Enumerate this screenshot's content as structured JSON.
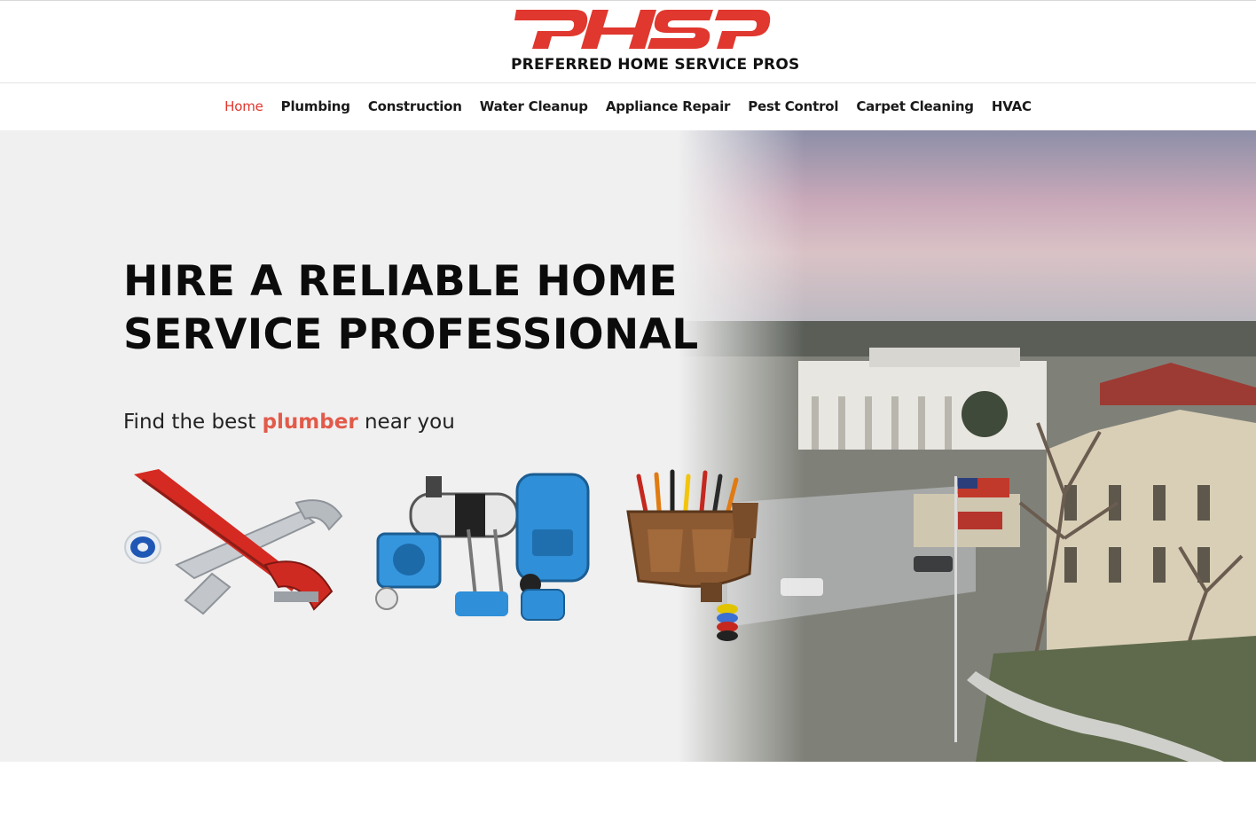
{
  "brand": {
    "logo_text": "PHSP",
    "tagline": "PREFERRED HOME SERVICE PROS",
    "logo_color": "#e0372e"
  },
  "nav": {
    "items": [
      {
        "label": "Home",
        "active": true
      },
      {
        "label": "Plumbing",
        "active": false
      },
      {
        "label": "Construction",
        "active": false
      },
      {
        "label": "Water Cleanup",
        "active": false
      },
      {
        "label": "Appliance Repair",
        "active": false
      },
      {
        "label": "Pest Control",
        "active": false
      },
      {
        "label": "Carpet Cleaning",
        "active": false
      },
      {
        "label": "HVAC",
        "active": false
      }
    ],
    "active_color": "#e0372e"
  },
  "hero": {
    "title_line1": "HIRE A RELIABLE HOME",
    "title_line2": "SERVICE PROFESSIONAL",
    "subtitle_prefix": "Find the best ",
    "subtitle_keyword": "plumber",
    "subtitle_suffix": " near you",
    "accent_color": "#e25a4a",
    "images": [
      {
        "icon": "plumbing-tools-image"
      },
      {
        "icon": "water-cleanup-equipment-image"
      },
      {
        "icon": "tool-belt-image"
      }
    ]
  }
}
